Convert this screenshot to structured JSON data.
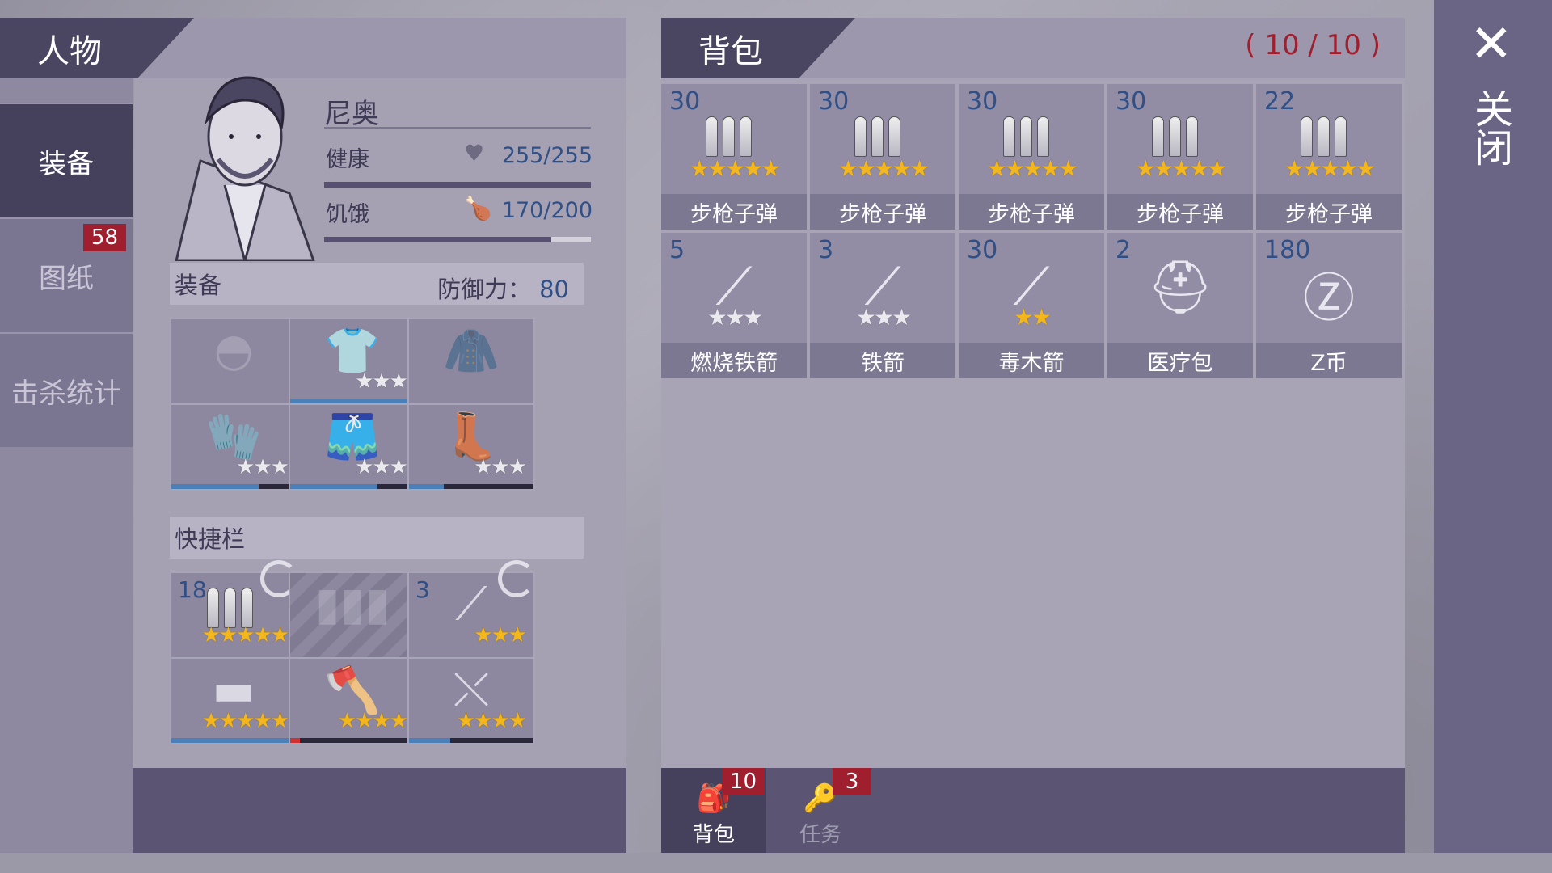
{
  "left": {
    "header_title": "人物",
    "nav": [
      {
        "label": "装备",
        "active": true
      },
      {
        "label": "图纸",
        "badge": "58"
      },
      {
        "label": "击杀统计"
      }
    ],
    "character": {
      "name": "尼奥",
      "health_label": "健康",
      "health_value": "255/255",
      "health_fraction": 1.0,
      "hunger_label": "饥饿",
      "hunger_value": "170/200",
      "hunger_fraction": 0.85
    },
    "equipment": {
      "title": "装备",
      "defense_label": "防御力：",
      "defense_value": "80",
      "slots": [
        {
          "icon": "beanie-icon",
          "empty": true
        },
        {
          "icon": "tshirt-icon",
          "stars": 3,
          "star_color": "silver",
          "durability": 1.0
        },
        {
          "icon": "jacket-icon",
          "empty": true
        },
        {
          "icon": "gloves-icon",
          "stars": 3,
          "star_color": "silver",
          "durability": 0.7
        },
        {
          "icon": "shorts-icon",
          "stars": 3,
          "star_color": "silver",
          "durability": 0.7
        },
        {
          "icon": "boots-icon",
          "stars": 3,
          "star_color": "silver",
          "durability": 0.28
        }
      ]
    },
    "quickbar": {
      "title": "快捷栏",
      "slots": [
        {
          "icon": "rifle-ammo-icon",
          "count": "18",
          "stars": 5,
          "star_color": "gold",
          "refresh": true
        },
        {
          "icon": "ammo-placeholder-icon",
          "empty": true,
          "hatched": true
        },
        {
          "icon": "spear-icon",
          "count": "3",
          "stars": 3,
          "star_color": "gold",
          "refresh": true
        },
        {
          "icon": "rifle-icon",
          "stars": 5,
          "star_color": "gold",
          "durability": 1.0
        },
        {
          "icon": "axe-icon",
          "stars": 4,
          "star_color": "gold",
          "durability": 0.08,
          "durability_color": "red"
        },
        {
          "icon": "crossbow-icon",
          "stars": 4,
          "star_color": "gold",
          "durability": 0.33
        }
      ]
    }
  },
  "backpack": {
    "title": "背包",
    "capacity": "( 10 / 10 )",
    "items": [
      {
        "count": "30",
        "icon": "rifle-ammo-icon",
        "stars": 5,
        "star_color": "gold",
        "label": "步枪子弹"
      },
      {
        "count": "30",
        "icon": "rifle-ammo-icon",
        "stars": 5,
        "star_color": "gold",
        "label": "步枪子弹"
      },
      {
        "count": "30",
        "icon": "rifle-ammo-icon",
        "stars": 5,
        "star_color": "gold",
        "label": "步枪子弹"
      },
      {
        "count": "30",
        "icon": "rifle-ammo-icon",
        "stars": 5,
        "star_color": "gold",
        "label": "步枪子弹"
      },
      {
        "count": "22",
        "icon": "rifle-ammo-icon",
        "stars": 5,
        "star_color": "gold",
        "label": "步枪子弹"
      },
      {
        "count": "5",
        "icon": "fire-arrow-icon",
        "stars": 3,
        "star_color": "silver",
        "label": "燃烧铁箭"
      },
      {
        "count": "3",
        "icon": "iron-arrow-icon",
        "stars": 3,
        "star_color": "silver",
        "label": "铁箭"
      },
      {
        "count": "30",
        "icon": "poison-arrow-icon",
        "stars": 2,
        "star_color": "gold",
        "label": "毒木箭"
      },
      {
        "count": "2",
        "icon": "medkit-icon",
        "stars": 0,
        "label": "医疗包"
      },
      {
        "count": "180",
        "icon": "z-coin-icon",
        "stars": 0,
        "label": "Z币"
      }
    ],
    "tabs": [
      {
        "label": "背包",
        "icon": "backpack-icon",
        "badge": "10",
        "active": true
      },
      {
        "label": "任务",
        "icon": "key-icon",
        "badge": "3",
        "active": false
      }
    ]
  },
  "close_label": "关闭",
  "colors": {
    "accent": "#45405c",
    "badge": "#a01f2e",
    "count_text": "#2f4f86",
    "star_gold": "#f3b71c"
  }
}
